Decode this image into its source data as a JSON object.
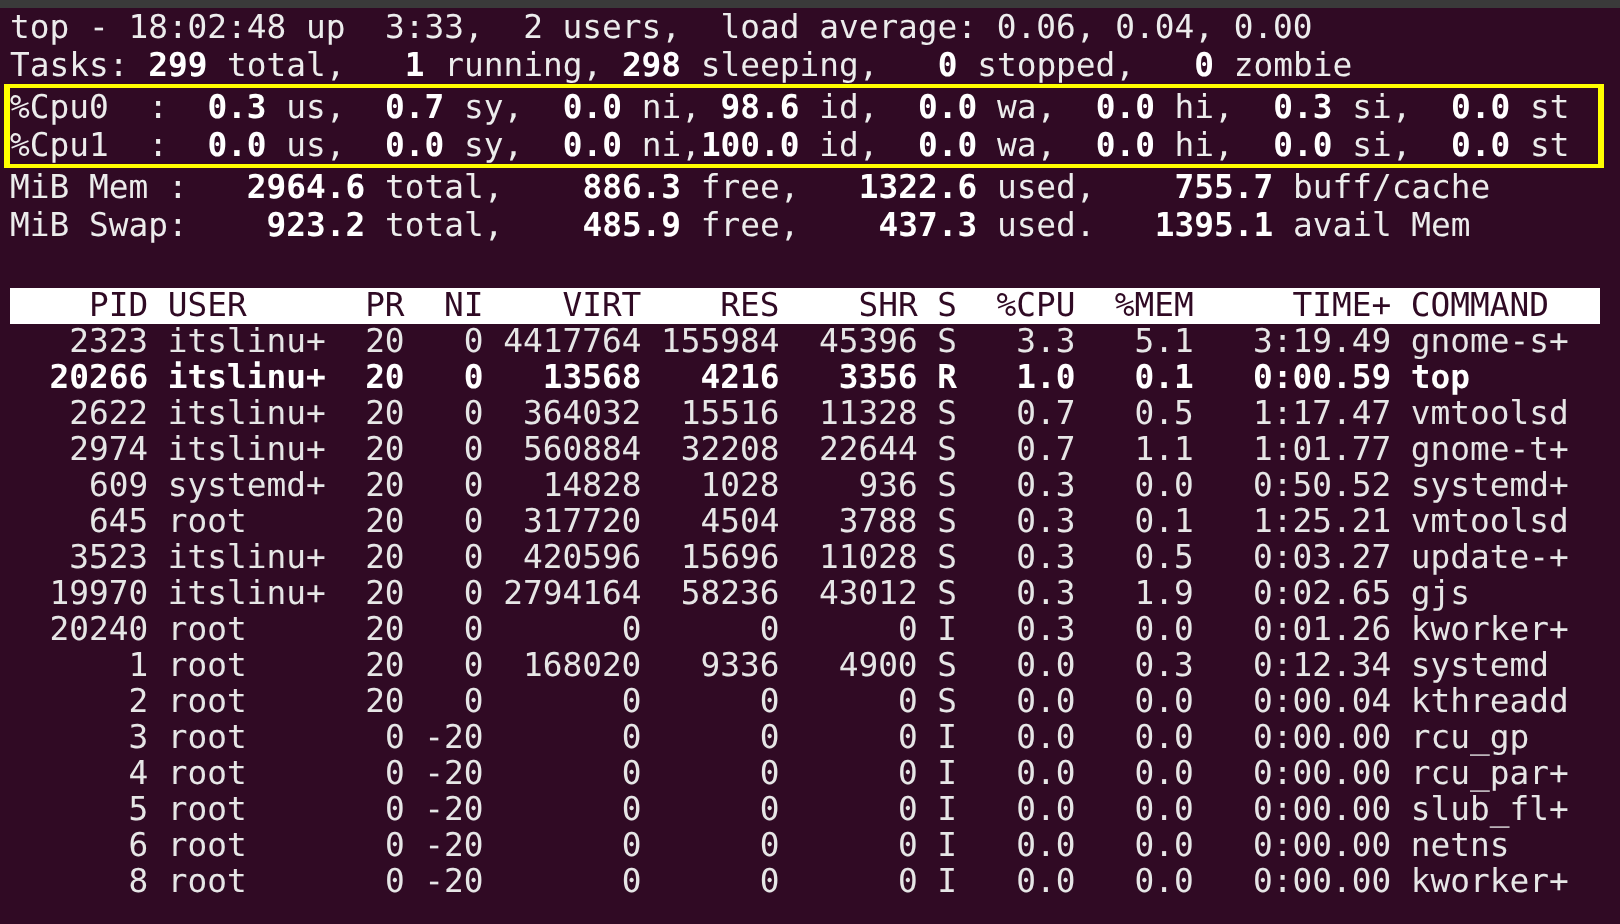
{
  "summary": {
    "uptime_line": "top - 18:02:48 up  3:33,  2 users,  load average: 0.06, 0.04, 0.00",
    "tasks_line": "Tasks: **299** total,   **1** running, **298** sleeping,   **0** stopped,   **0** zombie",
    "cpu_highlighted": true,
    "cpu_lines": [
      "%Cpu0  :  **0.3** us,  **0.7** sy,  **0.0** ni, **98.6** id,  **0.0** wa,  **0.0** hi,  **0.3** si,  **0.0** st",
      "%Cpu1  :  **0.0** us,  **0.0** sy,  **0.0** ni,**100.0** id,  **0.0** wa,  **0.0** hi,  **0.0** si,  **0.0** st"
    ],
    "mem_line": "MiB Mem :   **2964.6** total,    **886.3** free,   **1322.6** used,    **755.7** buff/cache",
    "swap_line": "MiB Swap:    **923.2** total,    **485.9** free,    **437.3** used.   **1395.1** avail Mem"
  },
  "table": {
    "columns": [
      "PID",
      "USER",
      "PR",
      "NI",
      "VIRT",
      "RES",
      "SHR",
      "S",
      "%CPU",
      "%MEM",
      "TIME+",
      "COMMAND"
    ],
    "rows": [
      {
        "highlighted": false,
        "cells": [
          "2323",
          "itslinu+",
          "20",
          "0",
          "4417764",
          "155984",
          "45396",
          "S",
          "3.3",
          "5.1",
          "3:19.49",
          "gnome-s+"
        ]
      },
      {
        "highlighted": true,
        "cells": [
          "20266",
          "itslinu+",
          "20",
          "0",
          "13568",
          "4216",
          "3356",
          "R",
          "1.0",
          "0.1",
          "0:00.59",
          "top"
        ]
      },
      {
        "highlighted": false,
        "cells": [
          "2622",
          "itslinu+",
          "20",
          "0",
          "364032",
          "15516",
          "11328",
          "S",
          "0.7",
          "0.5",
          "1:17.47",
          "vmtoolsd"
        ]
      },
      {
        "highlighted": false,
        "cells": [
          "2974",
          "itslinu+",
          "20",
          "0",
          "560884",
          "32208",
          "22644",
          "S",
          "0.7",
          "1.1",
          "1:01.77",
          "gnome-t+"
        ]
      },
      {
        "highlighted": false,
        "cells": [
          "609",
          "systemd+",
          "20",
          "0",
          "14828",
          "1028",
          "936",
          "S",
          "0.3",
          "0.0",
          "0:50.52",
          "systemd+"
        ]
      },
      {
        "highlighted": false,
        "cells": [
          "645",
          "root",
          "20",
          "0",
          "317720",
          "4504",
          "3788",
          "S",
          "0.3",
          "0.1",
          "1:25.21",
          "vmtoolsd"
        ]
      },
      {
        "highlighted": false,
        "cells": [
          "3523",
          "itslinu+",
          "20",
          "0",
          "420596",
          "15696",
          "11028",
          "S",
          "0.3",
          "0.5",
          "0:03.27",
          "update-+"
        ]
      },
      {
        "highlighted": false,
        "cells": [
          "19970",
          "itslinu+",
          "20",
          "0",
          "2794164",
          "58236",
          "43012",
          "S",
          "0.3",
          "1.9",
          "0:02.65",
          "gjs"
        ]
      },
      {
        "highlighted": false,
        "cells": [
          "20240",
          "root",
          "20",
          "0",
          "0",
          "0",
          "0",
          "I",
          "0.3",
          "0.0",
          "0:01.26",
          "kworker+"
        ]
      },
      {
        "highlighted": false,
        "cells": [
          "1",
          "root",
          "20",
          "0",
          "168020",
          "9336",
          "4900",
          "S",
          "0.0",
          "0.3",
          "0:12.34",
          "systemd"
        ]
      },
      {
        "highlighted": false,
        "cells": [
          "2",
          "root",
          "20",
          "0",
          "0",
          "0",
          "0",
          "S",
          "0.0",
          "0.0",
          "0:00.04",
          "kthreadd"
        ]
      },
      {
        "highlighted": false,
        "cells": [
          "3",
          "root",
          "0",
          "-20",
          "0",
          "0",
          "0",
          "I",
          "0.0",
          "0.0",
          "0:00.00",
          "rcu_gp"
        ]
      },
      {
        "highlighted": false,
        "cells": [
          "4",
          "root",
          "0",
          "-20",
          "0",
          "0",
          "0",
          "I",
          "0.0",
          "0.0",
          "0:00.00",
          "rcu_par+"
        ]
      },
      {
        "highlighted": false,
        "cells": [
          "5",
          "root",
          "0",
          "-20",
          "0",
          "0",
          "0",
          "I",
          "0.0",
          "0.0",
          "0:00.00",
          "slub_fl+"
        ]
      },
      {
        "highlighted": false,
        "cells": [
          "6",
          "root",
          "0",
          "-20",
          "0",
          "0",
          "0",
          "I",
          "0.0",
          "0.0",
          "0:00.00",
          "netns"
        ]
      },
      {
        "highlighted": false,
        "cells": [
          "8",
          "root",
          "0",
          "-20",
          "0",
          "0",
          "0",
          "I",
          "0.0",
          "0.0",
          "0:00.00",
          "kworker+"
        ]
      }
    ]
  }
}
